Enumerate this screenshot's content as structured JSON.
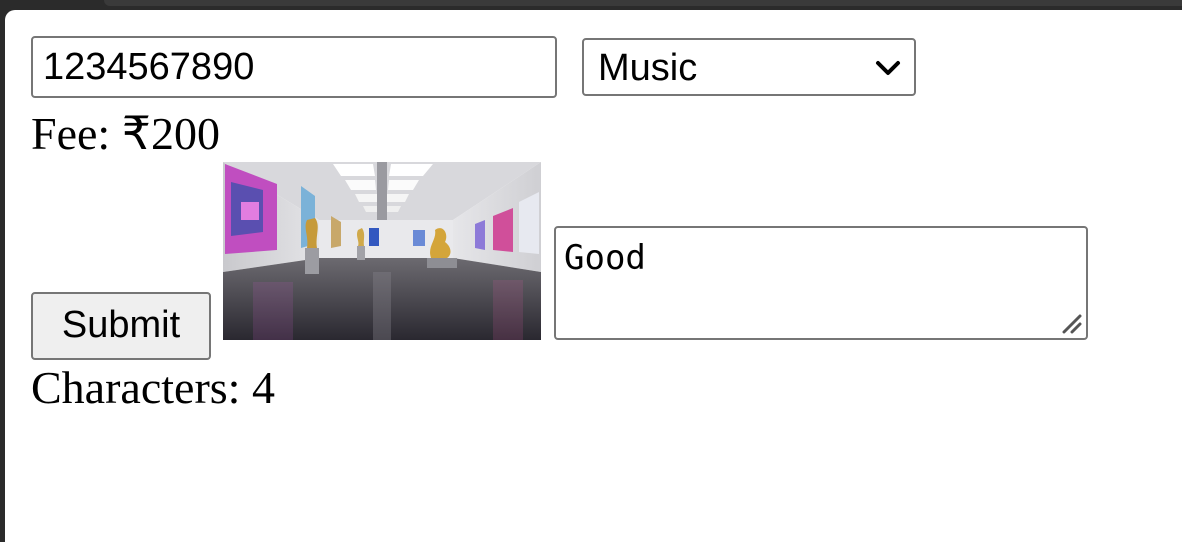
{
  "form": {
    "phone_value": "1234567890",
    "category_selected": "Music",
    "fee_text": "Fee: ₹200",
    "submit_label": "Submit",
    "comment_value": "Good",
    "char_count_text": "Characters: 4"
  },
  "icons": {
    "select_arrow": "chevron-down-icon",
    "textarea_grip": "resize-grip-icon"
  },
  "colors": {
    "border": "#767676",
    "button_bg": "#efefef",
    "page_bg": "#ffffff",
    "chrome_bg": "#2b2b2b"
  }
}
